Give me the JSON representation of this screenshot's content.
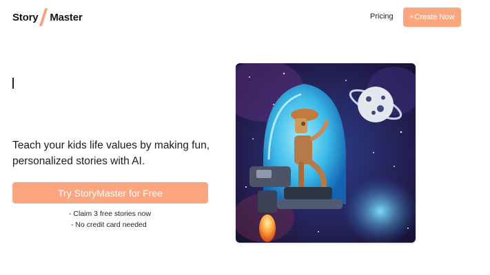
{
  "header": {
    "logo": {
      "left_word": "Story",
      "right_word": "Master"
    },
    "nav": {
      "pricing_label": "Pricing"
    },
    "create_button": {
      "icon": "plus-icon",
      "label": "Create Now"
    }
  },
  "hero": {
    "tagline": "Teach your kids life values by making fun, personalized stories with AI.",
    "cta_label": "Try StoryMaster for Free",
    "perks": [
      "- Claim 3 free stories now",
      "-  No credit card needed"
    ],
    "image": {
      "description_icon": "robot-astronaut-painting"
    }
  },
  "colors": {
    "accent": "#fca680",
    "text": "#111111",
    "background": "#ffffff"
  }
}
